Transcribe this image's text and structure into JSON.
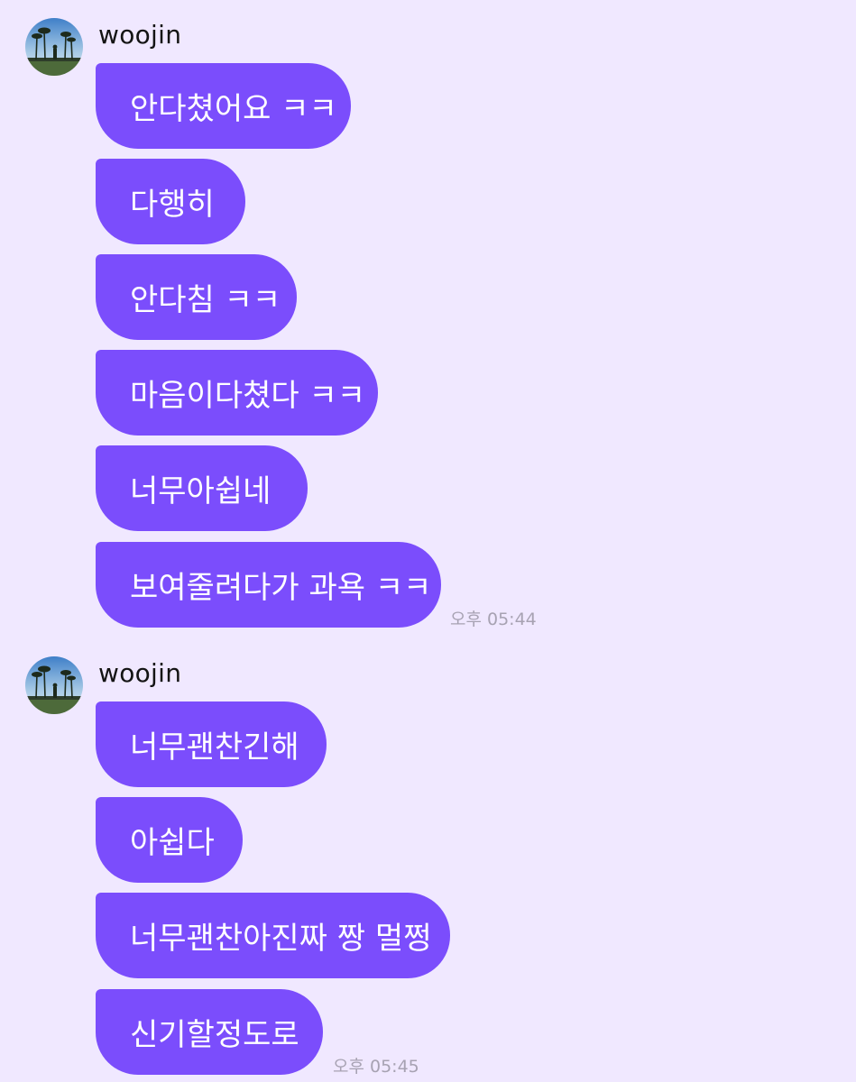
{
  "colors": {
    "background": "#f0e8ff",
    "bubble": "#7b4dfc",
    "bubble_text": "#ffffff",
    "timestamp": "#a7a2b2"
  },
  "groups": [
    {
      "sender": "woojin",
      "avatar_icon": "profile-photo-palm-trees",
      "messages": [
        "안다쳤어요 ㅋㅋ",
        "다행히",
        "안다침 ㅋㅋ",
        "마음이다쳤다 ㅋㅋ",
        "너무아쉽네",
        "보여줄려다가 과욕 ㅋㅋ"
      ],
      "time": "오후 05:44"
    },
    {
      "sender": "woojin",
      "avatar_icon": "profile-photo-palm-trees",
      "messages": [
        "너무괜찬긴해",
        "아쉽다",
        "너무괜찬아진짜 짱 멀쩡",
        "신기할정도로"
      ],
      "time": "오후 05:45"
    }
  ]
}
